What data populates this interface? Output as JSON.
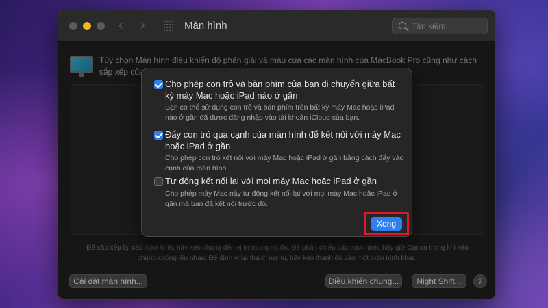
{
  "window": {
    "title": "Màn hình",
    "search_placeholder": "Tìm kiếm"
  },
  "main": {
    "description": "Tùy chọn Màn hình điều khiển độ phân giải và màu của các màn hình của MacBook Pro cũng như cách sắp xếp của ... O Apple của bạn.",
    "arrange_hint": "Để sắp xếp lại các màn hình, hãy kéo chúng đến vị trí mong muốn. Để phản chiếu các màn hình, hãy giữ Option trong khi kéo chúng chồng lên nhau. Để định vị lại thanh menu, hãy kéo thanh đó vào một màn hình khác.",
    "buttons": {
      "display_settings": "Cài đặt màn hình...",
      "universal_control": "Điều khiển chung...",
      "night_shift": "Night Shift...",
      "help": "?"
    }
  },
  "sheet": {
    "options": [
      {
        "label": "Cho phép con trỏ và bàn phím của bạn di chuyển giữa bất kỳ máy Mac hoặc iPad nào ở gần",
        "help": "Bạn có thể sử dụng con trỏ và bàn phím trên bất kỳ máy Mac hoặc iPad nào ở gần đã được đăng nhập vào tài khoản iCloud của bạn.",
        "checked": true
      },
      {
        "label": "Đẩy con trỏ qua cạnh của màn hình để kết nối với máy Mac hoặc iPad ở gần",
        "help": "Cho phép con trỏ kết nối với máy Mac hoặc iPad ở gần bằng cách đẩy vào cạnh của màn hình.",
        "checked": true
      },
      {
        "label": "Tự động kết nối lại với mọi máy Mac hoặc iPad ở gần",
        "help": "Cho phép máy Mac này tự động kết nối lại với mọi máy Mac hoặc iPad ở gần mà bạn đã kết nối trước đó.",
        "checked": false
      }
    ],
    "done_label": "Xong"
  },
  "colors": {
    "accent": "#2f7ff0",
    "highlight": "#e0162b"
  }
}
